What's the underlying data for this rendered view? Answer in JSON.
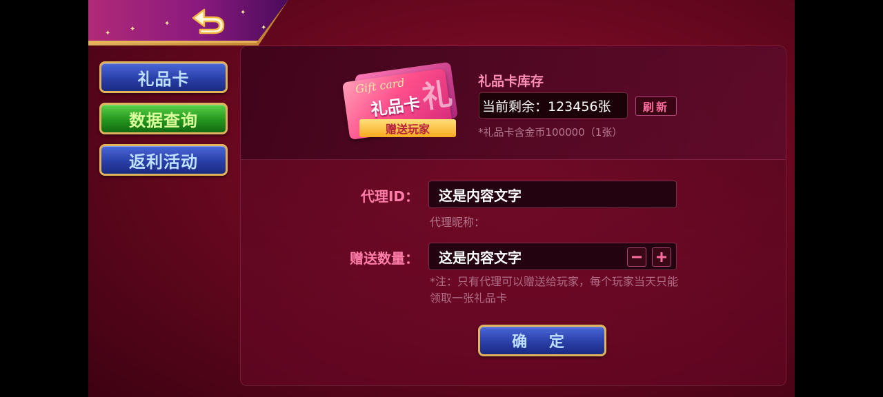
{
  "sidebar": {
    "items": [
      {
        "label": "礼品卡",
        "style": "blue"
      },
      {
        "label": "数据查询",
        "style": "green"
      },
      {
        "label": "返利活动",
        "style": "blue"
      }
    ]
  },
  "giftcard": {
    "en_text": "Gift card",
    "cn_text": "礼品卡",
    "big_char": "礼",
    "ribbon": "赠送玩家"
  },
  "stock": {
    "title": "礼品卡库存",
    "remaining": "当前剩余：123456张",
    "refresh_label": "刷新",
    "note": "*礼品卡含金币100000（1张）"
  },
  "form": {
    "agent_id_label": "代理ID：",
    "agent_id_value": "这是内容文字",
    "nickname_label": "代理昵称：",
    "quantity_label": "赠送数量：",
    "quantity_value": "这是内容文字",
    "note": "*注：只有代理可以赠送给玩家，每个玩家当天只能领取一张礼品卡",
    "confirm_label": "确 定"
  },
  "colors": {
    "background": "#6a0820",
    "accent_gold": "#e0b35c",
    "label_pink": "#ff7ea9",
    "button_blue": "#2a3fa8",
    "button_green": "#24961e"
  },
  "icons": {
    "back": "back-arrow-icon",
    "minus": "minus-icon",
    "plus": "plus-icon"
  }
}
